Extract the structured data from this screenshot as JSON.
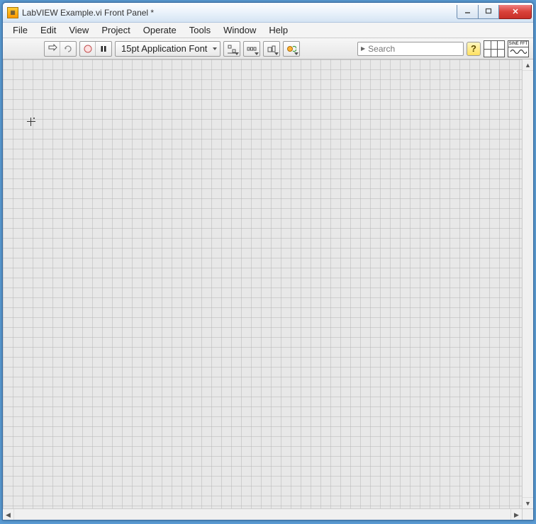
{
  "window": {
    "title": "LabVIEW Example.vi Front Panel *"
  },
  "menu": {
    "items": [
      "File",
      "Edit",
      "View",
      "Project",
      "Operate",
      "Tools",
      "Window",
      "Help"
    ]
  },
  "toolbar": {
    "font_label": "15pt Application Font",
    "search_placeholder": "Search",
    "help_label": "?",
    "vi_icon_label": "SINE FFT"
  }
}
